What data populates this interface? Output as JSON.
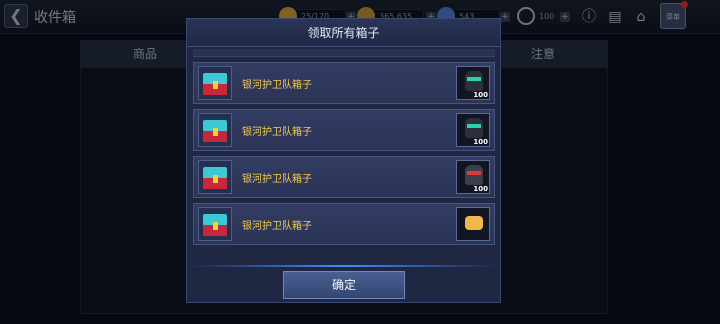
{
  "hud": {
    "title": "收件箱",
    "resource1": "25/120",
    "resource2": "365,635",
    "resource3": "543",
    "resource4": "100",
    "avatar_label": "菜单"
  },
  "background": {
    "col_goods": "商品",
    "col_note": "注意"
  },
  "modal": {
    "title": "领取所有箱子",
    "items": [
      {
        "name": "银河护卫队箱子",
        "count": "100",
        "reward_icon": "helmet-green-visor-icon"
      },
      {
        "name": "银河护卫队箱子",
        "count": "100",
        "reward_icon": "helmet-green-visor-icon"
      },
      {
        "name": "银河护卫队箱子",
        "count": "100",
        "reward_icon": "helmet-red-eyes-icon"
      },
      {
        "name": "银河护卫队箱子",
        "count": "",
        "reward_icon": "gold-item-icon"
      }
    ],
    "confirm_label": "确定"
  },
  "colors": {
    "accent_gold": "#f2c94c",
    "modal_bg": "#1f2742",
    "highlight_blue": "#3f8dff"
  }
}
